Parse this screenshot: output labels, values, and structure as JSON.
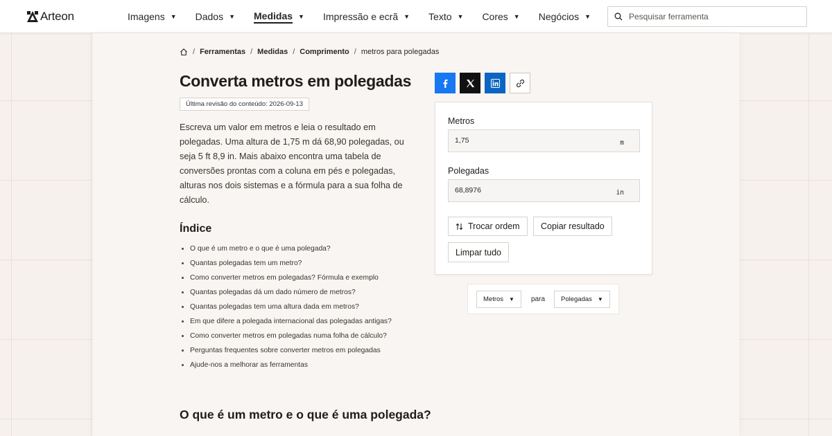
{
  "brand": {
    "name": "Arteon"
  },
  "nav": {
    "items": [
      {
        "label": "Imagens"
      },
      {
        "label": "Dados"
      },
      {
        "label": "Medidas"
      },
      {
        "label": "Impressão e ecrã"
      },
      {
        "label": "Texto"
      },
      {
        "label": "Cores"
      },
      {
        "label": "Negócios"
      }
    ],
    "active": "Medidas"
  },
  "search": {
    "placeholder": "Pesquisar ferramenta"
  },
  "breadcrumb": {
    "items": [
      "Ferramentas",
      "Medidas",
      "Comprimento"
    ],
    "current": "metros para polegadas"
  },
  "page": {
    "title": "Converta metros em polegadas",
    "revision": "Última revisão do conteúdo: 2026-09-13",
    "intro": "Escreva um valor em metros e leia o resultado em polegadas. Uma altura de 1,75 m dá 68,90 polegadas, ou seja 5 ft 8,9 in. Mais abaixo encontra uma tabela de conversões prontas com a coluna em pés e polegadas, alturas nos dois sistemas e a fórmula para a sua folha de cálculo."
  },
  "toc": {
    "title": "Índice",
    "items": [
      "O que é um metro e o que é uma polegada?",
      "Quantas polegadas tem um metro?",
      "Como converter metros em polegadas? Fórmula e exemplo",
      "Quantas polegadas dá um dado número de metros?",
      "Quantas polegadas tem uma altura dada em metros?",
      "Em que difere a polegada internacional das polegadas antigas?",
      "Como converter metros em polegadas numa folha de cálculo?",
      "Perguntas frequentes sobre converter metros em polegadas",
      "Ajude-nos a melhorar as ferramentas"
    ]
  },
  "section": {
    "heading": "O que é um metro e o que é uma polegada?"
  },
  "converter": {
    "from_label": "Metros",
    "from_value": "1,75",
    "from_unit": "m",
    "to_label": "Polegadas",
    "to_value": "68,8976",
    "to_unit": "in",
    "swap_label": "Trocar ordem",
    "copy_label": "Copiar resultado",
    "clear_label": "Limpar tudo"
  },
  "unit_picker": {
    "from": "Metros",
    "connector": "para",
    "to": "Polegadas"
  },
  "colors": {
    "facebook": "#1877f2",
    "x": "#111111",
    "linkedin": "#0a66c2",
    "background": "#f6f1ec"
  }
}
